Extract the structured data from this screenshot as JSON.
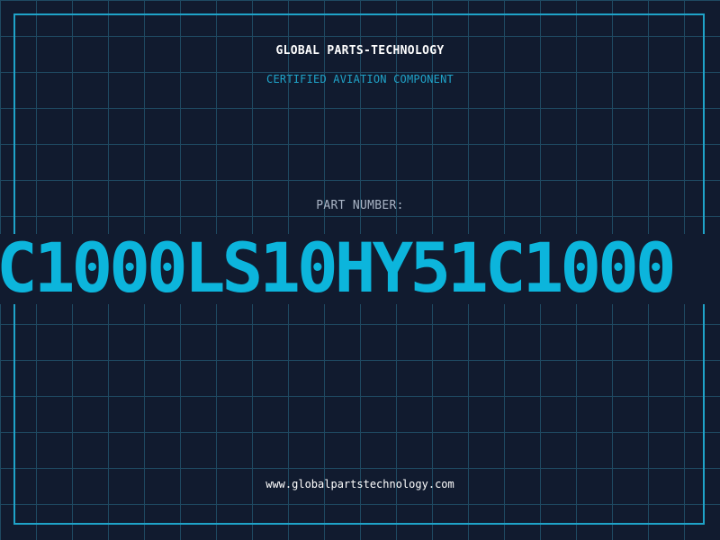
{
  "label": {
    "company": "GLOBAL PARTS-TECHNOLOGY",
    "subtitle": "CERTIFIED AVIATION COMPONENT",
    "part_number_label": "PART NUMBER:",
    "part_number": "C1000LS10HY51C1000",
    "website": "www.globalpartstechnology.com"
  },
  "colors": {
    "background": "#111b2f",
    "grid": "#1f4a62",
    "accent": "#1fa3c8",
    "part_number": "#0cb5dc",
    "text": "#ffffff"
  }
}
